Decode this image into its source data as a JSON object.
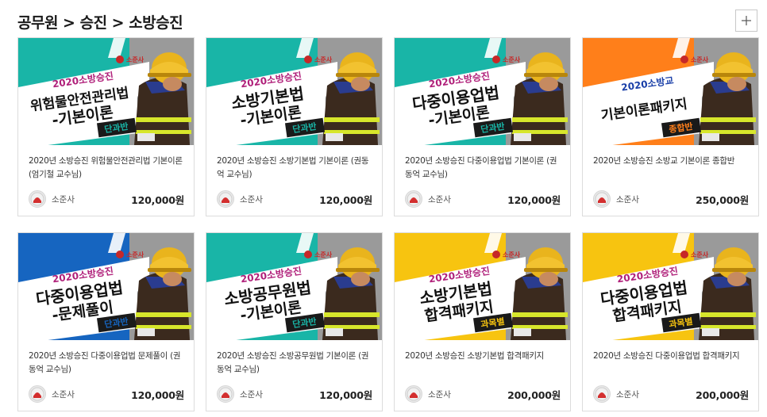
{
  "header": {
    "title": "공무원 > 승진 > 소방승진"
  },
  "colors": {
    "teal": "#19b5a7",
    "orange": "#ff7f1a",
    "blue": "#1665c0",
    "yellow": "#f7c410",
    "gray": "#8f8f8f"
  },
  "cards": [
    {
      "bg": "teal",
      "year_label": "2020소방승진",
      "title_line1": "위험물안전관리법",
      "title_line2": "-기본이론",
      "badge": "단과반",
      "description": "2020년 소방승진 위험물안전관리법 기본이론 (엄기철 교수님)",
      "seller": "소준사",
      "price": "120,000원"
    },
    {
      "bg": "teal",
      "year_label": "2020소방승진",
      "title_line1": "소방기본법",
      "title_line2": "-기본이론",
      "badge": "단과반",
      "description": "2020년 소방승진 소방기본법 기본이론 (권동억 교수님)",
      "seller": "소준사",
      "price": "120,000원"
    },
    {
      "bg": "teal",
      "year_label": "2020소방승진",
      "title_line1": "다중이용업법",
      "title_line2": "-기본이론",
      "badge": "단과반",
      "description": "2020년 소방승진 다중이용업법 기본이론 (권동억 교수님)",
      "seller": "소준사",
      "price": "120,000원"
    },
    {
      "bg": "orange",
      "year_label": "2020소방교",
      "title_line1": "기본이론패키지",
      "title_line2": "",
      "badge": "종합반",
      "description": "2020년 소방승진 소방교 기본이론 종합반",
      "seller": "소준사",
      "price": "250,000원"
    },
    {
      "bg": "blue",
      "year_label": "2020소방승진",
      "title_line1": "다중이용업법",
      "title_line2": "-문제풀이",
      "badge": "단과반",
      "description": "2020년 소방승진 다중이용업법 문제풀이 (권동억 교수님)",
      "seller": "소준사",
      "price": "120,000원"
    },
    {
      "bg": "teal",
      "year_label": "2020소방승진",
      "title_line1": "소방공무원법",
      "title_line2": "-기본이론",
      "badge": "단과반",
      "description": "2020년 소방승진 소방공무원법 기본이론 (권동억 교수님)",
      "seller": "소준사",
      "price": "120,000원"
    },
    {
      "bg": "yellow",
      "year_label": "2020소방승진",
      "title_line1": "소방기본법",
      "title_line2": "합격패키지",
      "badge": "과목별",
      "description": "2020년 소방승진 소방기본법 합격패키지",
      "seller": "소준사",
      "price": "200,000원"
    },
    {
      "bg": "yellow",
      "year_label": "2020소방승진",
      "title_line1": "다중이용업법",
      "title_line2": "합격패키지",
      "badge": "과목별",
      "description": "2020년 소방승진 다중이용업법 합격패키지",
      "seller": "소준사",
      "price": "200,000원"
    }
  ],
  "brand_logo_text": "소준사",
  "icons": {
    "plus": "plus-icon",
    "avatar": "seller-logo-icon"
  }
}
